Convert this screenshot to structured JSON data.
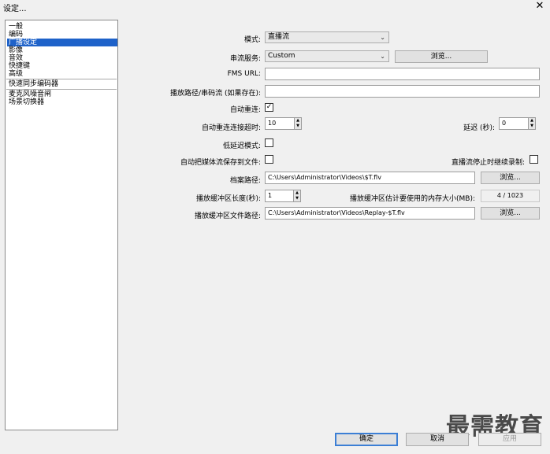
{
  "window": {
    "title": "设定...",
    "close_glyph": "✕"
  },
  "sidebar": {
    "items": [
      "一般",
      "编码",
      "广播设定",
      "影像",
      "音效",
      "快捷键",
      "高级",
      "快速同步编码器",
      "麦克风噪音闸",
      "场景切换器"
    ]
  },
  "form": {
    "mode_label": "模式:",
    "mode_value": "直播流",
    "service_label": "串流服务:",
    "service_value": "Custom",
    "service_browse": "浏览...",
    "fms_label": "FMS URL:",
    "fms_value": "",
    "path_label": "播放路径/串码流 (如果存在):",
    "path_value": "",
    "auto_reconnect_label": "自动重连:",
    "auto_reconnect_checked": true,
    "reconnect_timeout_label": "自动重连连接超时:",
    "reconnect_timeout_value": "10",
    "delay_label": "延迟 (秒):",
    "delay_value": "0",
    "low_latency_label": "低延迟模式:",
    "save_to_file_label": "自动把媒体流保存到文件:",
    "keep_recording_label": "直播流停止时继续录制:",
    "file_path_label": "档案路径:",
    "file_path_value": "C:\\Users\\Administrator\\Videos\\$T.flv",
    "file_browse": "浏览...",
    "replay_len_label": "播放缓冲区长度(秒):",
    "replay_len_value": "1",
    "replay_mem_label": "播放缓冲区估计要使用的内存大小(MB):",
    "replay_mem_value": "4 / 1023",
    "replay_path_label": "播放缓冲区文件路径:",
    "replay_path_value": "C:\\Users\\Administrator\\Videos\\Replay-$T.flv",
    "replay_browse": "浏览..."
  },
  "footer": {
    "ok": "确定",
    "cancel": "取消",
    "apply": "应用"
  },
  "watermark": "最需教育",
  "colors": {
    "selected": "#1e62c9",
    "default_button_border": "#3c7fd5"
  }
}
